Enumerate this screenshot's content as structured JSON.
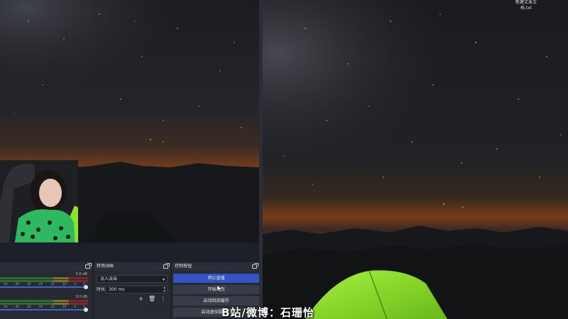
{
  "desktop": {
    "file_name_line1": "新建文本文",
    "file_name_line2": "档.txt"
  },
  "docks": {
    "audio": {
      "meters": [
        {
          "db": "0.0 dB",
          "scale": [
            "-50",
            "-40",
            "-30",
            "-20",
            "-15",
            "-10",
            "-5",
            "0"
          ]
        },
        {
          "db": "0.0 dB",
          "scale": [
            "-50",
            "-40",
            "-30",
            "-20",
            "-15",
            "-10",
            "-5",
            "0"
          ]
        }
      ]
    },
    "transitions": {
      "title": "转场动画",
      "selected": "淡入淡出",
      "duration_label": "时长",
      "duration_value": "300 ms"
    },
    "controls": {
      "title": "控制按钮",
      "stop_stream": "停止直播",
      "start_record": "开始录制",
      "start_replay_buffer": "启动回放缓存",
      "start_virtual_camera": "启动虚拟摄像机"
    }
  },
  "overlay": {
    "watermark": "B站/微博：石珊怡"
  },
  "colors": {
    "accent": "#3454c4",
    "dock_bg": "#272a33",
    "tent_green": "#8fe02a"
  }
}
